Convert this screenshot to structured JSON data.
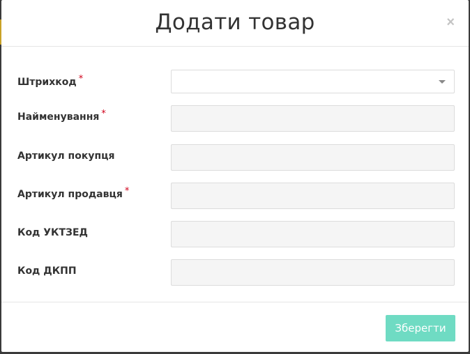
{
  "modal": {
    "title": "Додати товар",
    "close_glyph": "×"
  },
  "fields": [
    {
      "label": "Штрихкод",
      "required": "*",
      "type": "select",
      "value": ""
    },
    {
      "label": "Найменування",
      "required": "*",
      "type": "text",
      "value": ""
    },
    {
      "label": "Артикул покупця",
      "required": "",
      "type": "text",
      "value": ""
    },
    {
      "label": "Артикул продавця",
      "required": "*",
      "type": "text",
      "value": ""
    },
    {
      "label": "Код УКТЗЕД",
      "required": "",
      "type": "text",
      "value": ""
    },
    {
      "label": "Код ДКПП",
      "required": "",
      "type": "text",
      "value": ""
    }
  ],
  "footer": {
    "save_label": "Зберегти"
  },
  "colors": {
    "accent": "#6fdbc3",
    "required": "#d0021b",
    "input_bg": "#f5f5f5"
  }
}
